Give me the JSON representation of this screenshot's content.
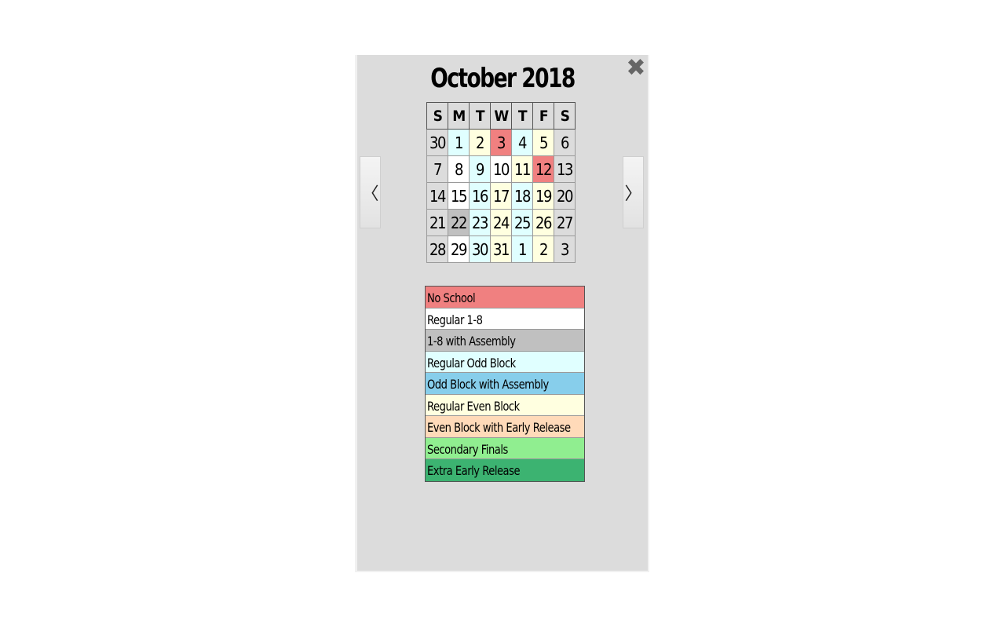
{
  "calendar": {
    "title": "October 2018",
    "close_icon": "close-x-icon",
    "close_glyph": "✖",
    "prev_glyph": "〈",
    "next_glyph": "〉",
    "weekday_headers": [
      "S",
      "M",
      "T",
      "W",
      "T",
      "F",
      "S"
    ],
    "weeks": [
      [
        {
          "day": "30",
          "type": "weekend"
        },
        {
          "day": "1",
          "type": "regular_odd"
        },
        {
          "day": "2",
          "type": "regular_even"
        },
        {
          "day": "3",
          "type": "no_school"
        },
        {
          "day": "4",
          "type": "regular_odd"
        },
        {
          "day": "5",
          "type": "regular_even"
        },
        {
          "day": "6",
          "type": "weekend"
        }
      ],
      [
        {
          "day": "7",
          "type": "weekend"
        },
        {
          "day": "8",
          "type": "regular_1_8"
        },
        {
          "day": "9",
          "type": "regular_odd"
        },
        {
          "day": "10",
          "type": "regular_1_8"
        },
        {
          "day": "11",
          "type": "regular_even"
        },
        {
          "day": "12",
          "type": "no_school"
        },
        {
          "day": "13",
          "type": "weekend"
        }
      ],
      [
        {
          "day": "14",
          "type": "weekend"
        },
        {
          "day": "15",
          "type": "regular_1_8"
        },
        {
          "day": "16",
          "type": "regular_odd"
        },
        {
          "day": "17",
          "type": "regular_even"
        },
        {
          "day": "18",
          "type": "regular_odd"
        },
        {
          "day": "19",
          "type": "regular_even"
        },
        {
          "day": "20",
          "type": "weekend"
        }
      ],
      [
        {
          "day": "21",
          "type": "weekend"
        },
        {
          "day": "22",
          "type": "assembly_1_8"
        },
        {
          "day": "23",
          "type": "regular_odd"
        },
        {
          "day": "24",
          "type": "regular_even"
        },
        {
          "day": "25",
          "type": "regular_odd"
        },
        {
          "day": "26",
          "type": "regular_even"
        },
        {
          "day": "27",
          "type": "weekend"
        }
      ],
      [
        {
          "day": "28",
          "type": "weekend"
        },
        {
          "day": "29",
          "type": "regular_1_8"
        },
        {
          "day": "30",
          "type": "regular_odd"
        },
        {
          "day": "31",
          "type": "regular_even"
        },
        {
          "day": "1",
          "type": "regular_odd"
        },
        {
          "day": "2",
          "type": "regular_even"
        },
        {
          "day": "3",
          "type": "weekend"
        }
      ]
    ]
  },
  "day_type_colors": {
    "weekend": "#dcdcdc",
    "no_school": "#f08080",
    "regular_1_8": "#ffffff",
    "assembly_1_8": "#c0c0c0",
    "regular_odd": "#e0ffff",
    "odd_assembly": "#87ceeb",
    "regular_even": "#ffffe0",
    "even_early": "#ffdab9",
    "finals": "#90ee90",
    "extra_early": "#3cb371"
  },
  "legend": [
    {
      "label": "No School",
      "type": "no_school"
    },
    {
      "label": "Regular 1-8",
      "type": "regular_1_8"
    },
    {
      "label": "1-8 with Assembly",
      "type": "assembly_1_8"
    },
    {
      "label": "Regular Odd Block",
      "type": "regular_odd"
    },
    {
      "label": "Odd Block with Assembly",
      "type": "odd_assembly"
    },
    {
      "label": "Regular Even Block",
      "type": "regular_even"
    },
    {
      "label": "Even Block with Early Release",
      "type": "even_early"
    },
    {
      "label": "Secondary Finals",
      "type": "finals"
    },
    {
      "label": "Extra Early Release",
      "type": "extra_early"
    }
  ]
}
